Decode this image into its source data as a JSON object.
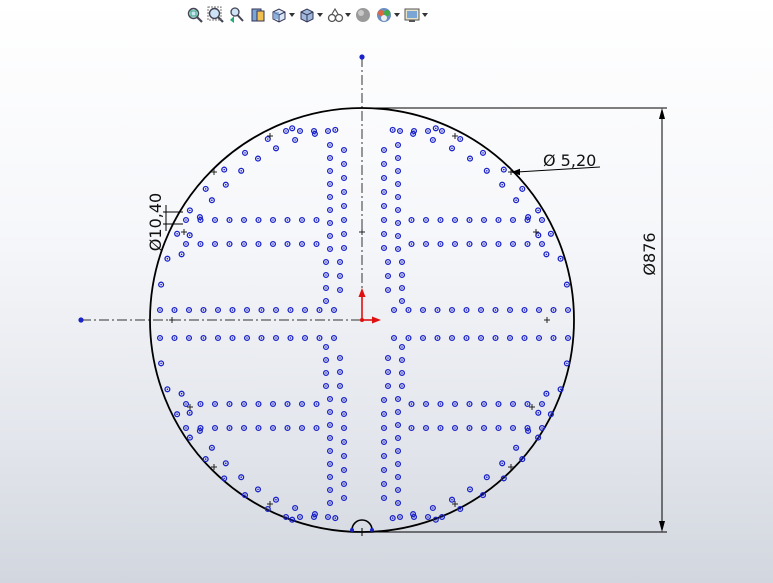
{
  "toolbar": {
    "buttons": [
      {
        "id": "zoom-to-fit",
        "icon": "zoom-to-fit-icon",
        "dropdown": false
      },
      {
        "id": "zoom-to-area",
        "icon": "zoom-to-area-icon",
        "dropdown": false
      },
      {
        "id": "previous-view",
        "icon": "previous-view-icon",
        "dropdown": false
      },
      {
        "id": "section-view",
        "icon": "section-view-icon",
        "dropdown": false
      },
      {
        "id": "view-orientation",
        "icon": "view-orientation-icon",
        "dropdown": true
      },
      {
        "id": "display-style",
        "icon": "display-style-icon",
        "dropdown": true
      },
      {
        "id": "hide-show-items",
        "icon": "hide-show-items-icon",
        "dropdown": true
      },
      {
        "id": "edit-appearance",
        "icon": "edit-appearance-icon",
        "dropdown": false
      },
      {
        "id": "apply-scene",
        "icon": "apply-scene-icon",
        "dropdown": true
      },
      {
        "id": "view-settings",
        "icon": "view-settings-icon",
        "dropdown": true
      }
    ]
  },
  "drawing": {
    "outer_diameter_label": "Ø876",
    "hole_diameter_label": "Ø 5,20",
    "spacing_label": "Ø10,40",
    "hole_color": "#1a22c8",
    "axis_x_color": "#e01010",
    "axis_y_color": "#e01010"
  }
}
